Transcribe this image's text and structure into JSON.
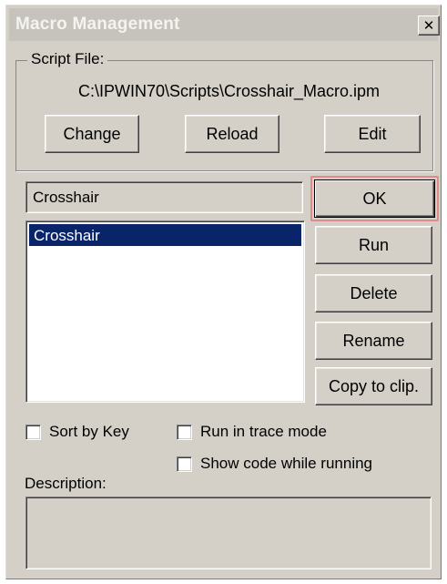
{
  "window": {
    "title": "Macro Management",
    "close_glyph": "✕",
    "close_icon": "close-icon"
  },
  "script_file": {
    "group_label": "Script File:",
    "path": "C:\\IPWIN70\\Scripts\\Crosshair_Macro.ipm",
    "buttons": {
      "change": "Change",
      "reload": "Reload",
      "edit": "Edit"
    }
  },
  "macro": {
    "name_value": "Crosshair",
    "list_items": [
      "Crosshair"
    ],
    "selected_index": 0
  },
  "actions": {
    "ok": "OK",
    "run": "Run",
    "delete": "Delete",
    "rename": "Rename",
    "copy": "Copy to clip."
  },
  "options": {
    "sort_by_key": {
      "label": "Sort by Key",
      "checked": false
    },
    "run_in_trace": {
      "label": "Run in trace mode",
      "checked": false
    },
    "show_code": {
      "label": "Show code while running",
      "checked": false
    }
  },
  "description": {
    "label": "Description:",
    "value": ""
  },
  "colors": {
    "dialog_face": "#d4d0c8",
    "inactive_title": "#c6c3bc",
    "selection": "#0a246a",
    "focus_highlight": "#e08a8a"
  }
}
